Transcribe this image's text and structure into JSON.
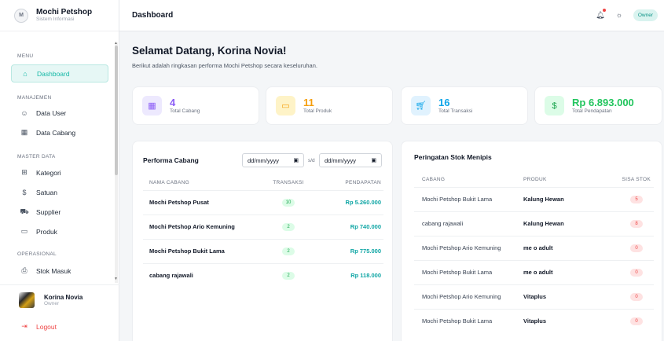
{
  "brand": {
    "name": "Mochi Petshop",
    "subtitle": "Sistem Informasi"
  },
  "sidebar": {
    "sections": {
      "menu": "MENU",
      "manajemen": "MANAJEMEN",
      "master_data": "MASTER DATA",
      "operasional": "OPERASIONAL"
    },
    "items": {
      "dashboard": "Dashboard",
      "data_user": "Data User",
      "data_cabang": "Data Cabang",
      "kategori": "Kategori",
      "satuan": "Satuan",
      "supplier": "Supplier",
      "produk": "Produk",
      "stok_masuk": "Stok Masuk"
    },
    "user": {
      "name": "Korina Novia",
      "role": "Owner"
    },
    "logout": "Logout"
  },
  "topbar": {
    "title": "Dashboard",
    "role_badge": "Owner"
  },
  "greeting": {
    "title": "Selamat Datang, Korina Novia!",
    "subtitle": "Berikut adalah ringkasan performa Mochi Petshop secara keseluruhan."
  },
  "stats": [
    {
      "value": "4",
      "label": "Total Cabang",
      "color": "#8b5cf6",
      "bg": "#ede9fe",
      "icon": "store-icon"
    },
    {
      "value": "11",
      "label": "Total Produk",
      "color": "#f59e0b",
      "bg": "#fef3c7",
      "icon": "archive-icon"
    },
    {
      "value": "16",
      "label": "Total Transaksi",
      "color": "#0ea5e9",
      "bg": "#e0f2fe",
      "icon": "cart-icon"
    },
    {
      "value": "Rp 6.893.000",
      "label": "Total Pendapatan",
      "color": "#22c55e",
      "bg": "#dcfce7",
      "icon": "dollar-icon"
    }
  ],
  "performa": {
    "title": "Performa Cabang",
    "date_from": "dd/mm/yyyy",
    "sd": "s/d",
    "date_to": "dd/mm/yyyy",
    "headers": {
      "nama": "NAMA CABANG",
      "transaksi": "TRANSAKSI",
      "pendapatan": "PENDAPATAN"
    },
    "rows": [
      {
        "nama": "Mochi Petshop Pusat",
        "transaksi": "10",
        "pendapatan": "Rp 5.260.000"
      },
      {
        "nama": "Mochi Petshop Ario Kemuning",
        "transaksi": "2",
        "pendapatan": "Rp 740.000"
      },
      {
        "nama": "Mochi Petshop Bukit Lama",
        "transaksi": "2",
        "pendapatan": "Rp 775.000"
      },
      {
        "nama": "cabang rajawali",
        "transaksi": "2",
        "pendapatan": "Rp 118.000"
      }
    ]
  },
  "stok": {
    "title": "Peringatan Stok Menipis",
    "headers": {
      "cabang": "CABANG",
      "produk": "PRODUK",
      "sisa": "SISA STOK"
    },
    "rows": [
      {
        "cabang": "Mochi Petshop Bukit Lama",
        "produk": "Kalung Hewan",
        "sisa": "5"
      },
      {
        "cabang": "cabang rajawali",
        "produk": "Kalung Hewan",
        "sisa": "8"
      },
      {
        "cabang": "Mochi Petshop Ario Kemuning",
        "produk": "me o adult",
        "sisa": "0"
      },
      {
        "cabang": "Mochi Petshop Bukit Lama",
        "produk": "me o adult",
        "sisa": "0"
      },
      {
        "cabang": "Mochi Petshop Ario Kemuning",
        "produk": "Vitaplus",
        "sisa": "0"
      },
      {
        "cabang": "Mochi Petshop Bukit Lama",
        "produk": "Vitaplus",
        "sisa": "0"
      }
    ]
  }
}
